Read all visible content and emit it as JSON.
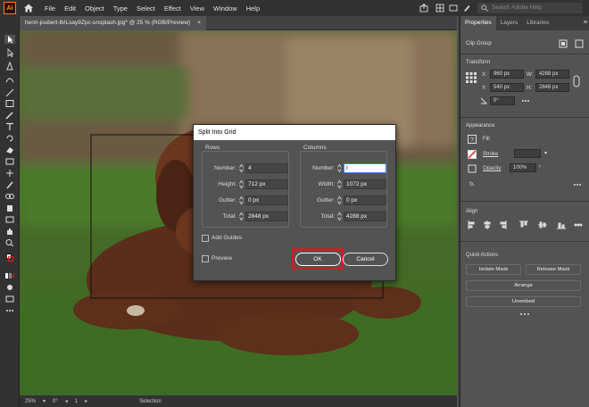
{
  "app": {
    "logo": "Ai",
    "menu": [
      "File",
      "Edit",
      "Object",
      "Type",
      "Select",
      "Effect",
      "View",
      "Window",
      "Help"
    ],
    "search_placeholder": "Search Adobe Help"
  },
  "document": {
    "tab_title": "henri-joubert-lb!Lsay9Zpc-unsplash.jpg* @ 25 % (RGB/Preview)",
    "close": "×"
  },
  "status": {
    "zoom": "25%",
    "angle": "0°",
    "artboard": "1",
    "mode": "Selection"
  },
  "panel": {
    "tabs": [
      "Properties",
      "Layers",
      "Libraries"
    ],
    "selection_type": "Clip Group",
    "transform": {
      "title": "Transform",
      "x_label": "X:",
      "x": "960 px",
      "y_label": "Y:",
      "y": "540 px",
      "w_label": "W:",
      "w": "4288 px",
      "h_label": "H:",
      "h": "2848 px",
      "angle": "0°"
    },
    "appearance": {
      "title": "Appearance",
      "fill": "Fill",
      "stroke": "Stroke",
      "opacity": "Opacity",
      "opacity_value": "100%",
      "fx": "fx."
    },
    "align": {
      "title": "Align"
    },
    "quick_actions": {
      "title": "Quick Actions",
      "isolate": "Isolate Mask",
      "release": "Release Mask",
      "arrange": "Arrange",
      "unembed": "Unembed"
    }
  },
  "dialog": {
    "title": "Split Into Grid",
    "rows": {
      "label": "Rows",
      "number_label": "Number:",
      "number": "4",
      "height_label": "Height:",
      "height": "712 px",
      "gutter_label": "Gutter:",
      "gutter": "0 px",
      "total_label": "Total:",
      "total": "2848 px"
    },
    "columns": {
      "label": "Columns",
      "number_label": "Number:",
      "number": "I",
      "width_label": "Width:",
      "width": "1072 px",
      "gutter_label": "Gutter:",
      "gutter": "0 px",
      "total_label": "Total:",
      "total": "4288 px"
    },
    "add_guides": "Add Guides",
    "preview": "Preview",
    "ok": "OK",
    "cancel": "Cancel"
  },
  "colors": {
    "highlight": "#c8202a",
    "accent": "#ff9a00"
  }
}
